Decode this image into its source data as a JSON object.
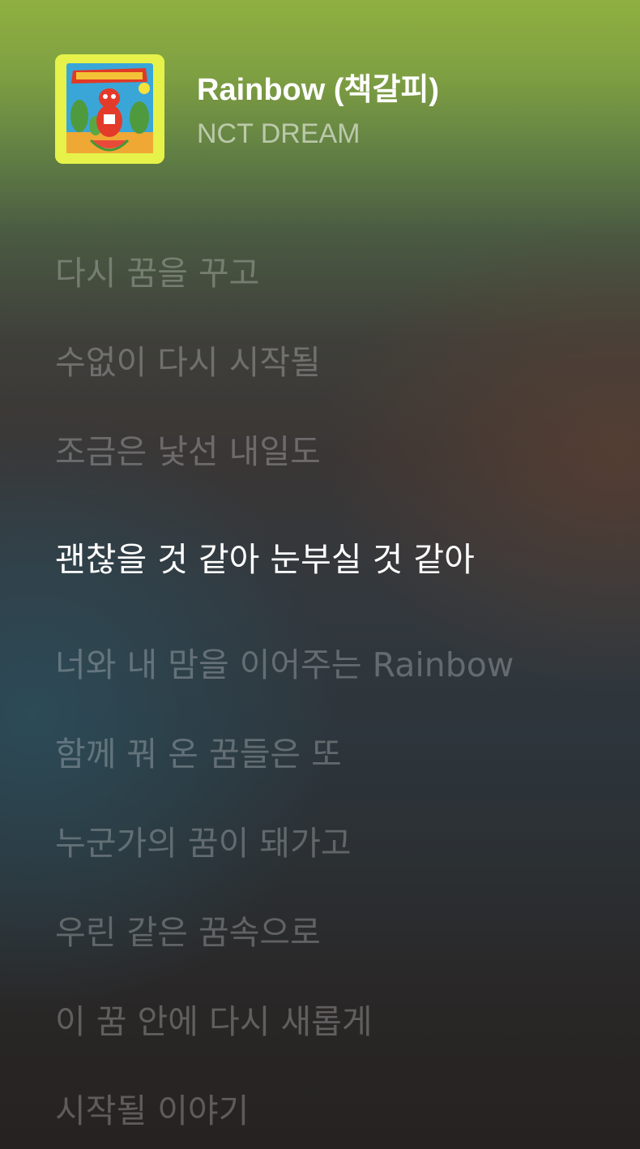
{
  "track": {
    "title": "Rainbow (책갈피)",
    "artist": "NCT DREAM",
    "album_art_icon": "album-cover"
  },
  "lyrics": {
    "active_index": 3,
    "lines": [
      "다시 꿈을 꾸고",
      "수없이 다시 시작될",
      "조금은 낯선 내일도",
      "괜찮을 것 같아 눈부실 것 같아",
      "너와 내 맘을 이어주는 Rainbow",
      "함께 꿔 온 꿈들은 또",
      "누군가의 꿈이 돼가고",
      "우린 같은 꿈속으로",
      "이 꿈 안에 다시 새롭게",
      "시작될 이야기"
    ]
  },
  "colors": {
    "active_lyric": "#ffffff",
    "inactive_lyric": "rgba(255,255,255,0.26)",
    "album_border": "#e6f24a"
  }
}
